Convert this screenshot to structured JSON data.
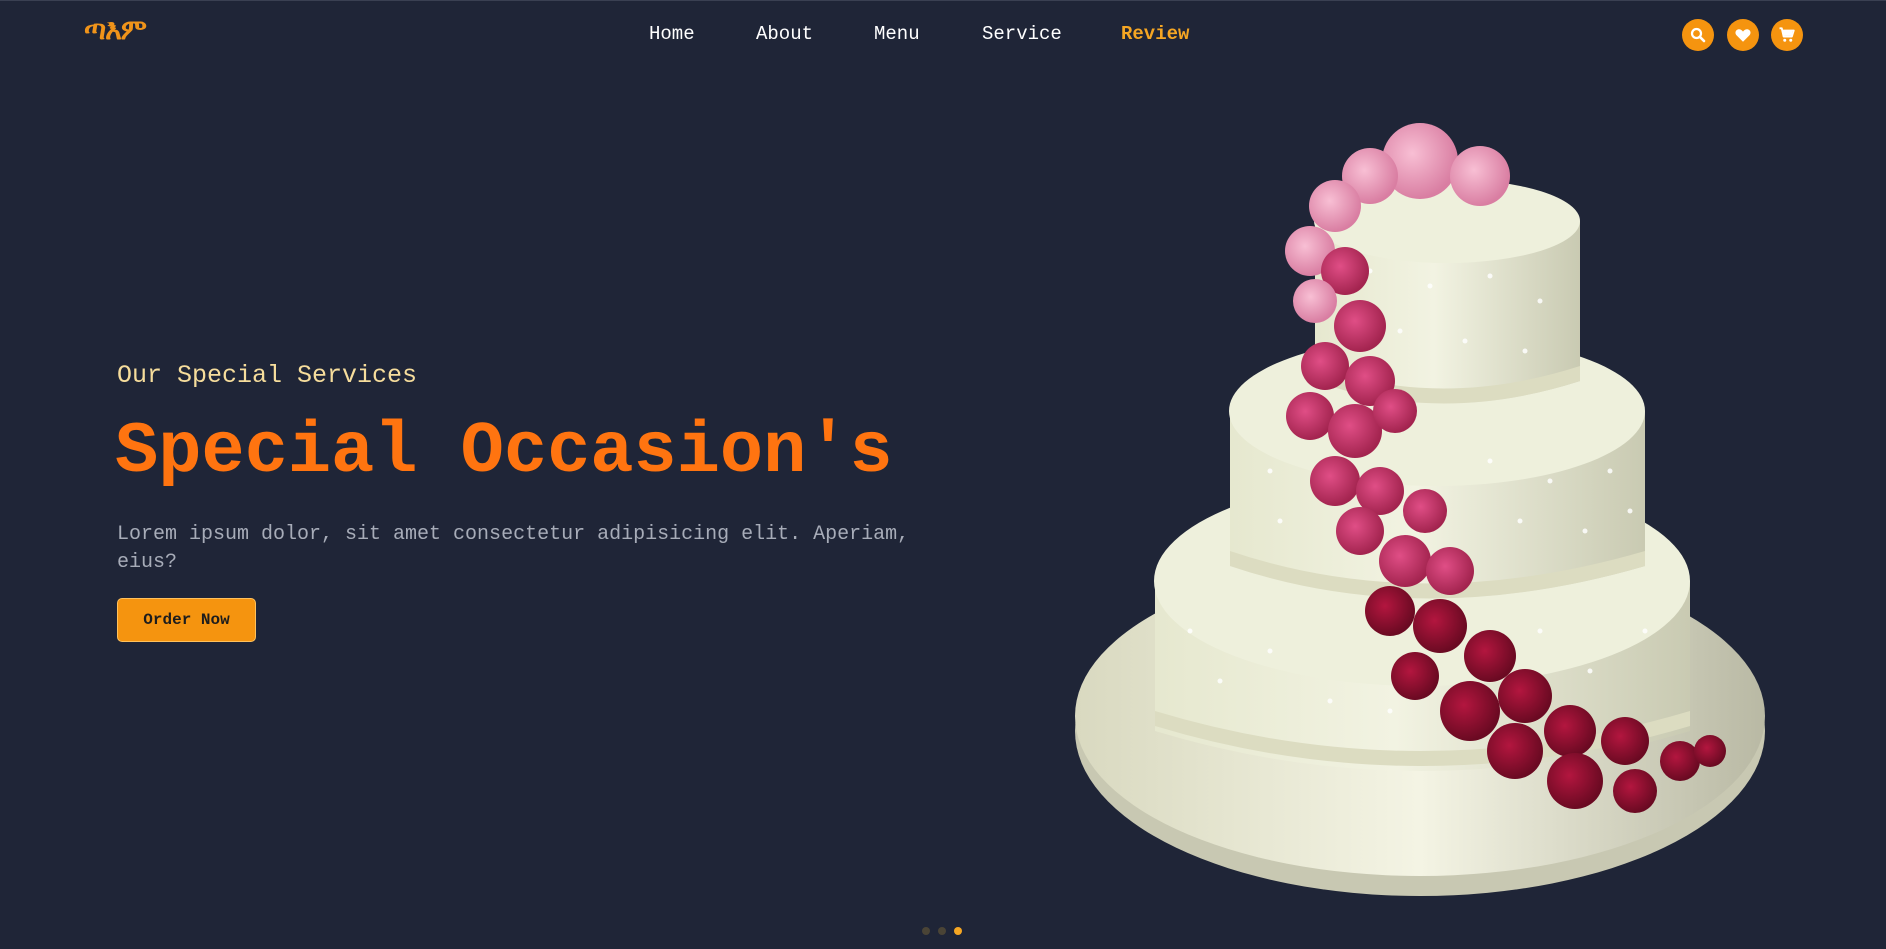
{
  "header": {
    "logo_text": "ጣእም",
    "nav": [
      {
        "label": "Home",
        "active": false
      },
      {
        "label": "About",
        "active": false
      },
      {
        "label": "Menu",
        "active": false
      },
      {
        "label": "Service",
        "active": false
      },
      {
        "label": "Review",
        "active": true
      }
    ],
    "actions": [
      {
        "icon": "search-icon"
      },
      {
        "icon": "heart-icon"
      },
      {
        "icon": "cart-icon"
      }
    ]
  },
  "hero": {
    "subtitle": "Our Special Services",
    "headline": "Special Occasion's",
    "description": "Lorem ipsum dolor, sit amet consectetur adipisicing elit. Aperiam, eius?",
    "cta_label": "Order Now",
    "image_subject": "three-tier white wedding cake with cascading pink and red roses"
  },
  "slider": {
    "total": 3,
    "active_index": 2
  },
  "colors": {
    "background": "#1f2537",
    "accent": "#f5940f",
    "headline": "#ff7410",
    "subtitle": "#f6dd9c",
    "active_nav": "#f5a623"
  }
}
